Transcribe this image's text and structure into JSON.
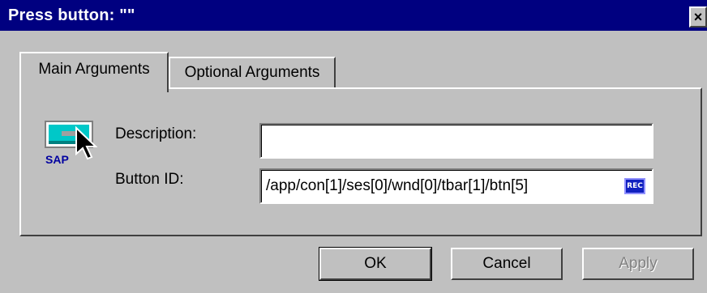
{
  "window": {
    "title": "Press button: \"\"",
    "close_glyph": "×"
  },
  "tabs": [
    {
      "label": "Main Arguments",
      "active": true
    },
    {
      "label": "Optional Arguments",
      "active": false
    }
  ],
  "form": {
    "icon_label": "SAP",
    "description_label": "Description:",
    "description_value": "",
    "button_id_label": "Button ID:",
    "button_id_value": "/app/con[1]/ses[0]/wnd[0]/tbar[1]/btn[5]",
    "rec_label": "REC"
  },
  "buttons": {
    "ok": "OK",
    "cancel": "Cancel",
    "apply": "Apply"
  },
  "colors": {
    "titlebar": "#000080",
    "face": "#c0c0c0",
    "rec": "#1020c0",
    "icon_cyan": "#00c8c8"
  }
}
